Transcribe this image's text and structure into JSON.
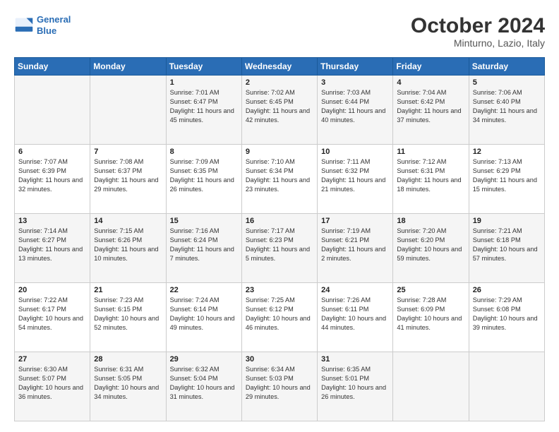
{
  "header": {
    "logo_line1": "General",
    "logo_line2": "Blue",
    "month": "October 2024",
    "location": "Minturno, Lazio, Italy"
  },
  "weekdays": [
    "Sunday",
    "Monday",
    "Tuesday",
    "Wednesday",
    "Thursday",
    "Friday",
    "Saturday"
  ],
  "weeks": [
    [
      {
        "day": "",
        "text": ""
      },
      {
        "day": "",
        "text": ""
      },
      {
        "day": "1",
        "text": "Sunrise: 7:01 AM\nSunset: 6:47 PM\nDaylight: 11 hours and 45 minutes."
      },
      {
        "day": "2",
        "text": "Sunrise: 7:02 AM\nSunset: 6:45 PM\nDaylight: 11 hours and 42 minutes."
      },
      {
        "day": "3",
        "text": "Sunrise: 7:03 AM\nSunset: 6:44 PM\nDaylight: 11 hours and 40 minutes."
      },
      {
        "day": "4",
        "text": "Sunrise: 7:04 AM\nSunset: 6:42 PM\nDaylight: 11 hours and 37 minutes."
      },
      {
        "day": "5",
        "text": "Sunrise: 7:06 AM\nSunset: 6:40 PM\nDaylight: 11 hours and 34 minutes."
      }
    ],
    [
      {
        "day": "6",
        "text": "Sunrise: 7:07 AM\nSunset: 6:39 PM\nDaylight: 11 hours and 32 minutes."
      },
      {
        "day": "7",
        "text": "Sunrise: 7:08 AM\nSunset: 6:37 PM\nDaylight: 11 hours and 29 minutes."
      },
      {
        "day": "8",
        "text": "Sunrise: 7:09 AM\nSunset: 6:35 PM\nDaylight: 11 hours and 26 minutes."
      },
      {
        "day": "9",
        "text": "Sunrise: 7:10 AM\nSunset: 6:34 PM\nDaylight: 11 hours and 23 minutes."
      },
      {
        "day": "10",
        "text": "Sunrise: 7:11 AM\nSunset: 6:32 PM\nDaylight: 11 hours and 21 minutes."
      },
      {
        "day": "11",
        "text": "Sunrise: 7:12 AM\nSunset: 6:31 PM\nDaylight: 11 hours and 18 minutes."
      },
      {
        "day": "12",
        "text": "Sunrise: 7:13 AM\nSunset: 6:29 PM\nDaylight: 11 hours and 15 minutes."
      }
    ],
    [
      {
        "day": "13",
        "text": "Sunrise: 7:14 AM\nSunset: 6:27 PM\nDaylight: 11 hours and 13 minutes."
      },
      {
        "day": "14",
        "text": "Sunrise: 7:15 AM\nSunset: 6:26 PM\nDaylight: 11 hours and 10 minutes."
      },
      {
        "day": "15",
        "text": "Sunrise: 7:16 AM\nSunset: 6:24 PM\nDaylight: 11 hours and 7 minutes."
      },
      {
        "day": "16",
        "text": "Sunrise: 7:17 AM\nSunset: 6:23 PM\nDaylight: 11 hours and 5 minutes."
      },
      {
        "day": "17",
        "text": "Sunrise: 7:19 AM\nSunset: 6:21 PM\nDaylight: 11 hours and 2 minutes."
      },
      {
        "day": "18",
        "text": "Sunrise: 7:20 AM\nSunset: 6:20 PM\nDaylight: 10 hours and 59 minutes."
      },
      {
        "day": "19",
        "text": "Sunrise: 7:21 AM\nSunset: 6:18 PM\nDaylight: 10 hours and 57 minutes."
      }
    ],
    [
      {
        "day": "20",
        "text": "Sunrise: 7:22 AM\nSunset: 6:17 PM\nDaylight: 10 hours and 54 minutes."
      },
      {
        "day": "21",
        "text": "Sunrise: 7:23 AM\nSunset: 6:15 PM\nDaylight: 10 hours and 52 minutes."
      },
      {
        "day": "22",
        "text": "Sunrise: 7:24 AM\nSunset: 6:14 PM\nDaylight: 10 hours and 49 minutes."
      },
      {
        "day": "23",
        "text": "Sunrise: 7:25 AM\nSunset: 6:12 PM\nDaylight: 10 hours and 46 minutes."
      },
      {
        "day": "24",
        "text": "Sunrise: 7:26 AM\nSunset: 6:11 PM\nDaylight: 10 hours and 44 minutes."
      },
      {
        "day": "25",
        "text": "Sunrise: 7:28 AM\nSunset: 6:09 PM\nDaylight: 10 hours and 41 minutes."
      },
      {
        "day": "26",
        "text": "Sunrise: 7:29 AM\nSunset: 6:08 PM\nDaylight: 10 hours and 39 minutes."
      }
    ],
    [
      {
        "day": "27",
        "text": "Sunrise: 6:30 AM\nSunset: 5:07 PM\nDaylight: 10 hours and 36 minutes."
      },
      {
        "day": "28",
        "text": "Sunrise: 6:31 AM\nSunset: 5:05 PM\nDaylight: 10 hours and 34 minutes."
      },
      {
        "day": "29",
        "text": "Sunrise: 6:32 AM\nSunset: 5:04 PM\nDaylight: 10 hours and 31 minutes."
      },
      {
        "day": "30",
        "text": "Sunrise: 6:34 AM\nSunset: 5:03 PM\nDaylight: 10 hours and 29 minutes."
      },
      {
        "day": "31",
        "text": "Sunrise: 6:35 AM\nSunset: 5:01 PM\nDaylight: 10 hours and 26 minutes."
      },
      {
        "day": "",
        "text": ""
      },
      {
        "day": "",
        "text": ""
      }
    ]
  ]
}
